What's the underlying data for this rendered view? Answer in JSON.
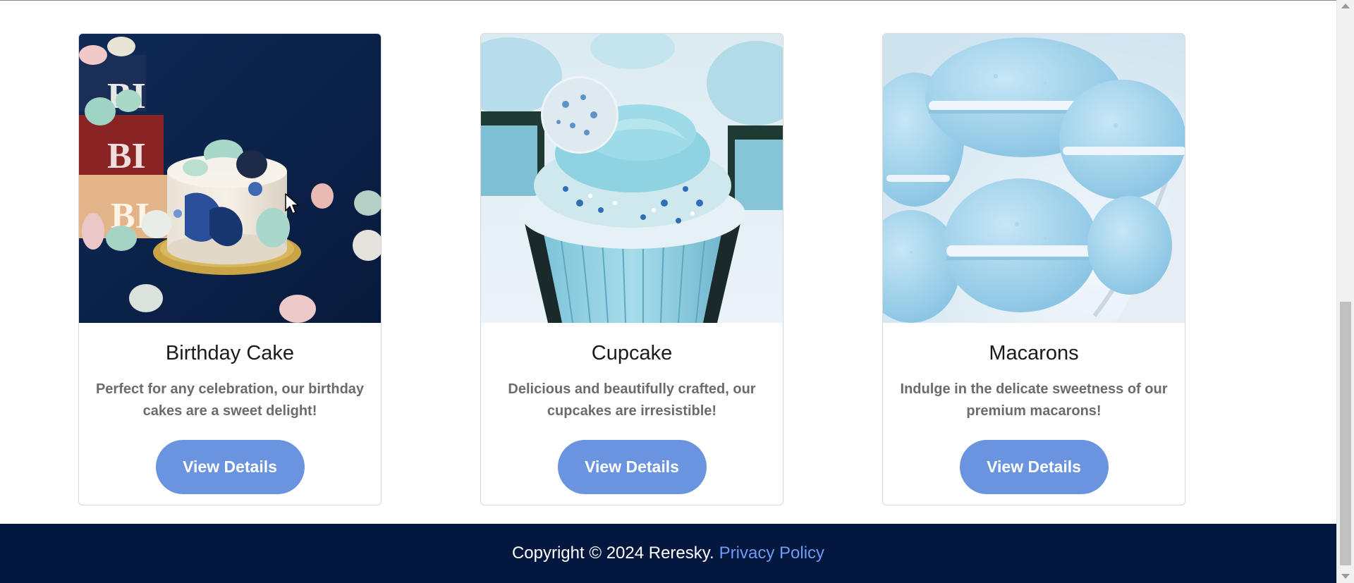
{
  "products": [
    {
      "title": "Birthday Cake",
      "description": "Perfect for any celebration, our birthday cakes are a sweet delight!",
      "button_label": "View Details",
      "image": "birthday-cake-photo"
    },
    {
      "title": "Cupcake",
      "description": "Delicious and beautifully crafted, our cupcakes are irresistible!",
      "button_label": "View Details",
      "image": "cupcake-photo"
    },
    {
      "title": "Macarons",
      "description": "Indulge in the delicate sweetness of our premium macarons!",
      "button_label": "View Details",
      "image": "macarons-photo"
    }
  ],
  "footer": {
    "copyright": "Copyright © 2024 Reresky.",
    "privacy_link": "Privacy Policy"
  },
  "colors": {
    "accent_button": "#6a94df",
    "footer_bg": "#03173f",
    "footer_link": "#6f9bf0",
    "description_text": "#6b6b6b"
  }
}
